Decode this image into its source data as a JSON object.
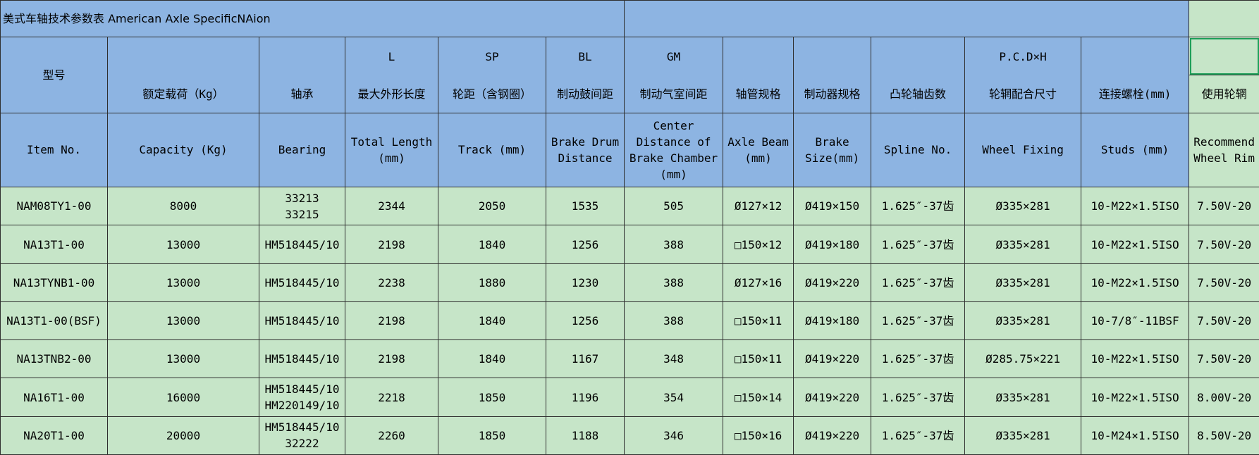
{
  "title": "美式车轴技术参数表  American Axle SpecificNAion",
  "header_rows": {
    "codes": [
      "L",
      "SP",
      "BL",
      "GM",
      "P.C.D×H"
    ],
    "model_cn": "型号",
    "cn": [
      "额定载荷（Kg）",
      "轴承",
      "最大外形长度",
      "轮距（含钢圈）",
      "制动鼓间距",
      "制动气室间距",
      "轴管规格",
      "制动器规格",
      "凸轮轴齿数",
      "轮辋配合尺寸",
      "连接螺栓(mm)",
      "使用轮辋"
    ],
    "en": {
      "item": "Item No.",
      "capacity": "Capacity (Kg)",
      "bearing": "Bearing",
      "total_length": [
        "Total Length",
        "(mm)"
      ],
      "track": "Track (mm)",
      "brake_drum": [
        "Brake Drum",
        "Distance"
      ],
      "center": [
        "Center",
        "Distance of",
        "Brake Chamber",
        "(mm)"
      ],
      "axle_beam": [
        "Axle Beam",
        "(mm)"
      ],
      "brake_size": [
        "Brake",
        "Size(mm)"
      ],
      "spline": "Spline No.",
      "wheel_fixing": "Wheel Fixing",
      "studs": "Studs (mm)",
      "recommend": [
        "Recommend",
        "Wheel Rim"
      ]
    }
  },
  "rows": [
    {
      "item": "NAM08TY1-00",
      "capacity": "8000",
      "bearing": [
        "33213",
        "33215"
      ],
      "length": "2344",
      "track": "2050",
      "bl": "1535",
      "gm": "505",
      "axle": "Ø127×12",
      "brake": "Ø419×150",
      "spline": "1.625″-37齿",
      "wheel": "Ø335×281",
      "studs": "10-M22×1.5ISO",
      "rim": "7.50V-20"
    },
    {
      "item": "NA13T1-00",
      "capacity": "13000",
      "bearing": [
        "HM518445/10"
      ],
      "length": "2198",
      "track": "1840",
      "bl": "1256",
      "gm": "388",
      "axle": "□150×12",
      "brake": "Ø419×180",
      "spline": "1.625″-37齿",
      "wheel": "Ø335×281",
      "studs": "10-M22×1.5ISO",
      "rim": "7.50V-20"
    },
    {
      "item": "NA13TYNB1-00",
      "capacity": "13000",
      "bearing": [
        "HM518445/10"
      ],
      "length": "2238",
      "track": "1880",
      "bl": "1230",
      "gm": "388",
      "axle": "Ø127×16",
      "brake": "Ø419×220",
      "spline": "1.625″-37齿",
      "wheel": "Ø335×281",
      "studs": "10-M22×1.5ISO",
      "rim": "7.50V-20"
    },
    {
      "item": "NA13T1-00(BSF)",
      "capacity": "13000",
      "bearing": [
        "HM518445/10"
      ],
      "length": "2198",
      "track": "1840",
      "bl": "1256",
      "gm": "388",
      "axle": "□150×11",
      "brake": "Ø419×180",
      "spline": "1.625″-37齿",
      "wheel": "Ø335×281",
      "studs": "10-7/8″-11BSF",
      "rim": "7.50V-20"
    },
    {
      "item": "NA13TNB2-00",
      "capacity": "13000",
      "bearing": [
        "HM518445/10"
      ],
      "length": "2198",
      "track": "1840",
      "bl": "1167",
      "gm": "348",
      "axle": "□150×11",
      "brake": "Ø419×220",
      "spline": "1.625″-37齿",
      "wheel": "Ø285.75×221",
      "studs": "10-M22×1.5ISO",
      "rim": "7.50V-20"
    },
    {
      "item": "NA16T1-00",
      "capacity": "16000",
      "bearing": [
        "HM518445/10",
        "HM220149/10"
      ],
      "length": "2218",
      "track": "1850",
      "bl": "1196",
      "gm": "354",
      "axle": "□150×14",
      "brake": "Ø419×220",
      "spline": "1.625″-37齿",
      "wheel": "Ø335×281",
      "studs": "10-M22×1.5ISO",
      "rim": "8.00V-20"
    },
    {
      "item": "NA20T1-00",
      "capacity": "20000",
      "bearing": [
        "HM518445/10",
        "32222"
      ],
      "length": "2260",
      "track": "1850",
      "bl": "1188",
      "gm": "346",
      "axle": "□150×16",
      "brake": "Ø419×220",
      "spline": "1.625″-37齿",
      "wheel": "Ø335×281",
      "studs": "10-M24×1.5ISO",
      "rim": "8.50V-20"
    }
  ]
}
